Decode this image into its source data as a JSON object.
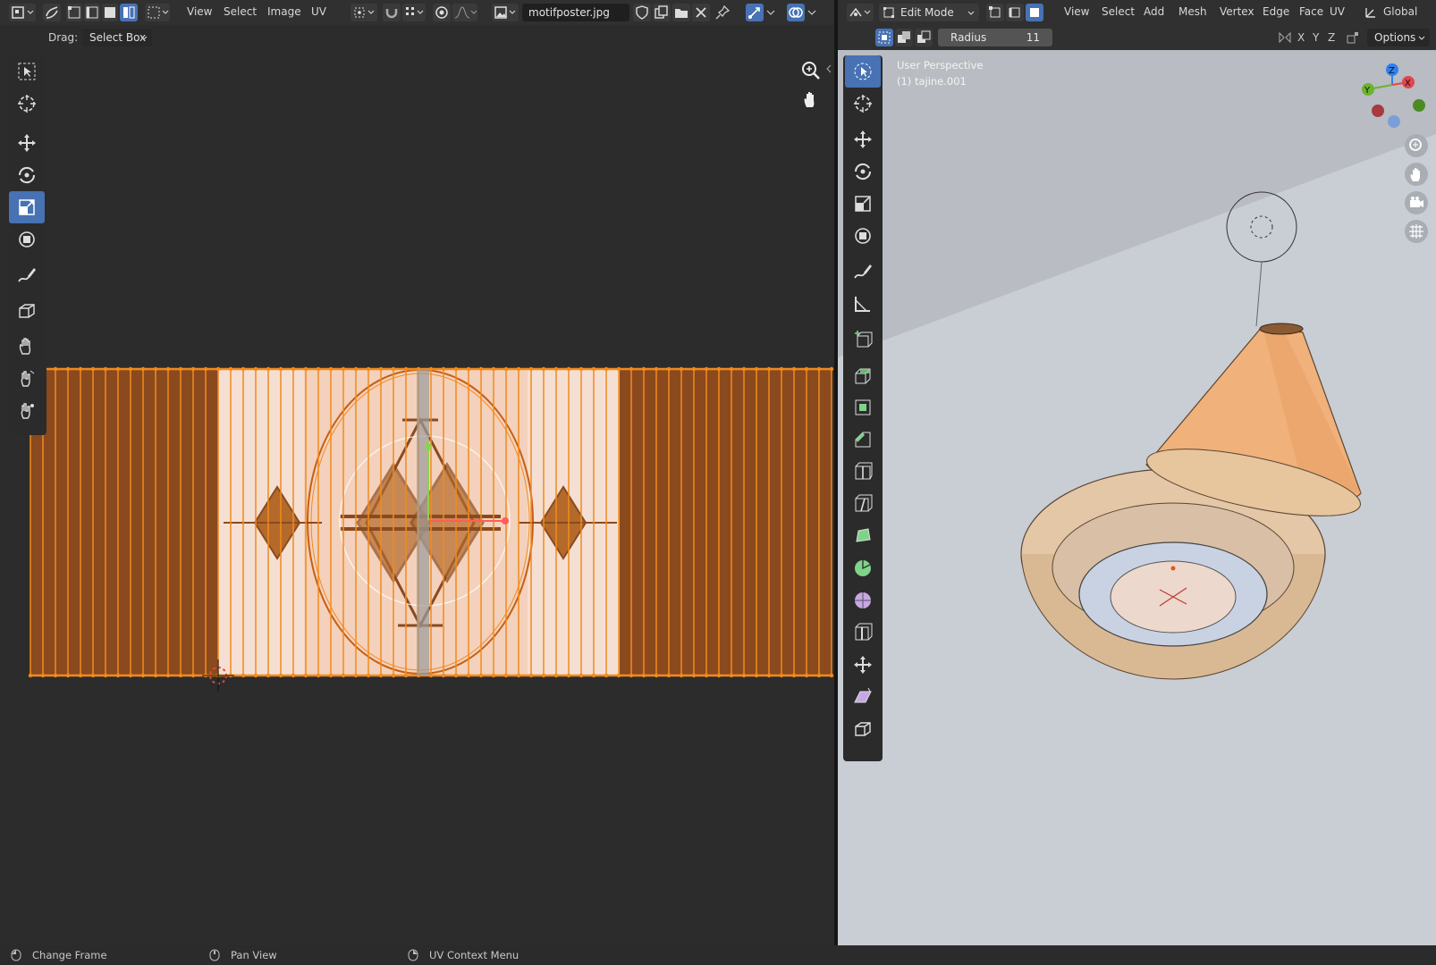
{
  "uv_editor": {
    "header": {
      "menus": [
        "View",
        "Select",
        "Image",
        "UV"
      ],
      "image_name": "motifposter.jpg"
    },
    "tool_header": {
      "drag_label": "Drag:",
      "drag_value": "Select Box"
    }
  },
  "viewport": {
    "header": {
      "mode": "Edit Mode",
      "menus": [
        "View",
        "Select",
        "Add",
        "Mesh",
        "Vertex",
        "Edge",
        "Face",
        "UV"
      ],
      "orientation": "Global"
    },
    "tool_header": {
      "radius_label": "Radius",
      "radius_value": "11",
      "axes": [
        "X",
        "Y",
        "Z"
      ],
      "options_label": "Options"
    },
    "overlay": {
      "perspective": "User Perspective",
      "object": "(1) tajine.001"
    },
    "gizmo_axes": {
      "z": "Z",
      "y": "Y",
      "x": "X"
    }
  },
  "status_bar": {
    "items": [
      "Change Frame",
      "Pan View",
      "UV Context Menu"
    ]
  },
  "colors": {
    "accent": "#4772b3",
    "uv_edge": "#f28a1c",
    "uv_face": "#8a4a1e",
    "viewport_bg": "#c8ccd3"
  }
}
